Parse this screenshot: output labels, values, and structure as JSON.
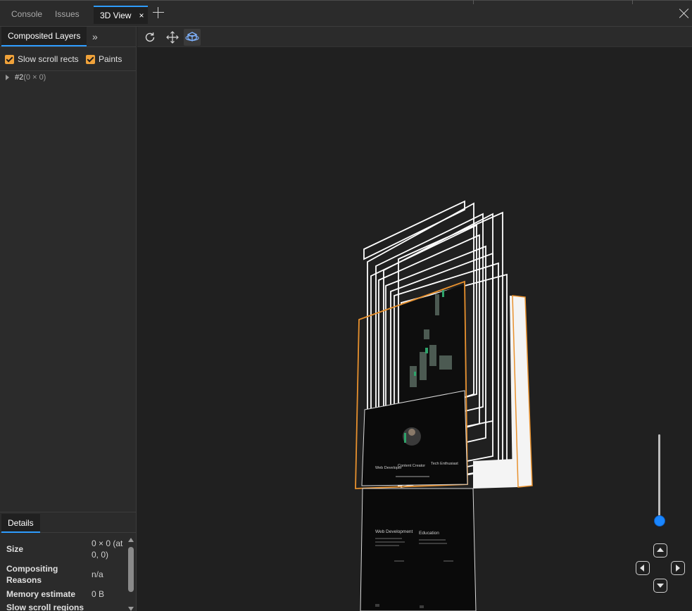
{
  "tabs": {
    "items": [
      {
        "label": "Console",
        "active": false
      },
      {
        "label": "Issues",
        "active": false
      },
      {
        "label": "3D View",
        "active": true,
        "close_glyph": "×"
      }
    ],
    "new_tab_icon": "plus-icon",
    "window_close_icon": "close-icon"
  },
  "left_panel": {
    "tab_label": "Composited Layers",
    "more_tabs_glyph": "»",
    "checkboxes": [
      {
        "label": "Slow scroll rects",
        "checked": true
      },
      {
        "label": "Paints",
        "checked": true
      }
    ],
    "tree": {
      "node_id": "#2",
      "node_size": "(0 × 0)"
    },
    "details": {
      "tab_label": "Details",
      "properties": [
        {
          "label": "Size",
          "value": "0 × 0 (at 0, 0)"
        },
        {
          "label": "Compositing Reasons",
          "value": "n/a"
        },
        {
          "label": "Memory estimate",
          "value": "0 B"
        },
        {
          "label": "Slow scroll regions",
          "value": ""
        }
      ]
    }
  },
  "toolbar": {
    "buttons": [
      {
        "icon": "refresh-icon"
      },
      {
        "icon": "pan-icon"
      },
      {
        "icon": "rotate-3d-icon",
        "active": true
      }
    ]
  },
  "scene": {
    "page_texts": {
      "nav_1": "Web Developer",
      "nav_2": "Content Creator",
      "nav_3": "Tech Enthusiast",
      "card_1": "Web Development",
      "card_2": "Education"
    }
  },
  "controls": {
    "zoom_level": 0.15,
    "pad_icons": [
      "pan-up-icon",
      "pan-left-icon",
      "pan-right-icon",
      "pan-down-icon"
    ]
  },
  "colors": {
    "accent": "#2e9cff",
    "checkbox": "#f0a23a",
    "selected_layer": "#e8912e",
    "layer_outline": "#ffffff",
    "zoom_thumb": "#1a86ff"
  }
}
